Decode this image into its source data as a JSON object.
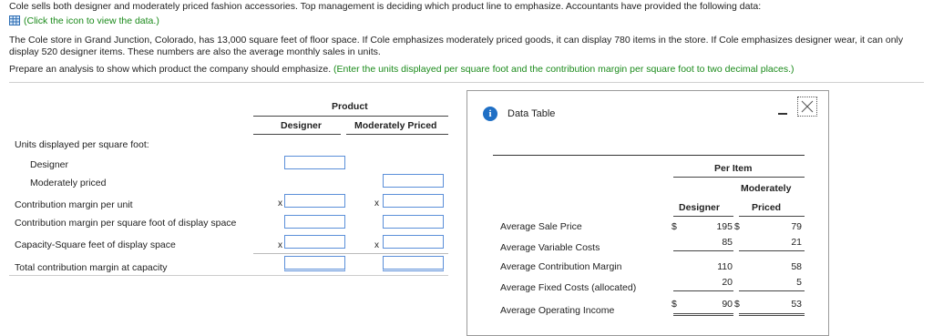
{
  "problem": {
    "intro": "Cole sells both designer and moderately priced fashion accessories. Top management is deciding which product line to emphasize. Accountants have provided the following data:",
    "data_link": "(Click the icon to view the data.)",
    "body": "The Cole store in Grand Junction, Colorado, has 13,000 square feet of floor space. If Cole emphasizes moderately priced goods, it can display 780 items in the store. If Cole emphasizes designer wear, it can only",
    "body2": "display 520 designer items. These numbers are also the average monthly sales in units.",
    "prepare": "Prepare an analysis to show which product the company should emphasize.",
    "prepare_hint": "(Enter the units displayed per square foot and the contribution margin per square foot to two decimal places.)"
  },
  "analysis": {
    "product_header": "Product",
    "col_designer": "Designer",
    "col_moderate": "Moderately Priced",
    "rows": {
      "units_header": "Units displayed per square foot:",
      "designer": "Designer",
      "moderate": "Moderately priced",
      "cm_unit": "Contribution margin per unit",
      "cm_sqft": "Contribution margin per square foot of display space",
      "capacity": "Capacity-Square feet of display space",
      "total": "Total contribution margin at capacity"
    },
    "x_symbol": "x"
  },
  "modal": {
    "title": "Data Table",
    "info_glyph": "i",
    "per_item": "Per Item",
    "col_designer": "Designer",
    "col_moderate_1": "Moderately",
    "col_moderate_2": "Priced",
    "rows": [
      {
        "label": "Average Sale Price",
        "sym": "$",
        "d": "195",
        "sym2": "$",
        "m": "79"
      },
      {
        "label": "Average Variable Costs",
        "sym": "",
        "d": "85",
        "sym2": "",
        "m": "21"
      },
      {
        "label": "Average Contribution Margin",
        "sym": "",
        "d": "110",
        "sym2": "",
        "m": "58"
      },
      {
        "label": "Average Fixed Costs (allocated)",
        "sym": "",
        "d": "20",
        "sym2": "",
        "m": "5"
      },
      {
        "label": "Average Operating Income",
        "sym": "$",
        "d": "90",
        "sym2": "$",
        "m": "53"
      }
    ]
  }
}
